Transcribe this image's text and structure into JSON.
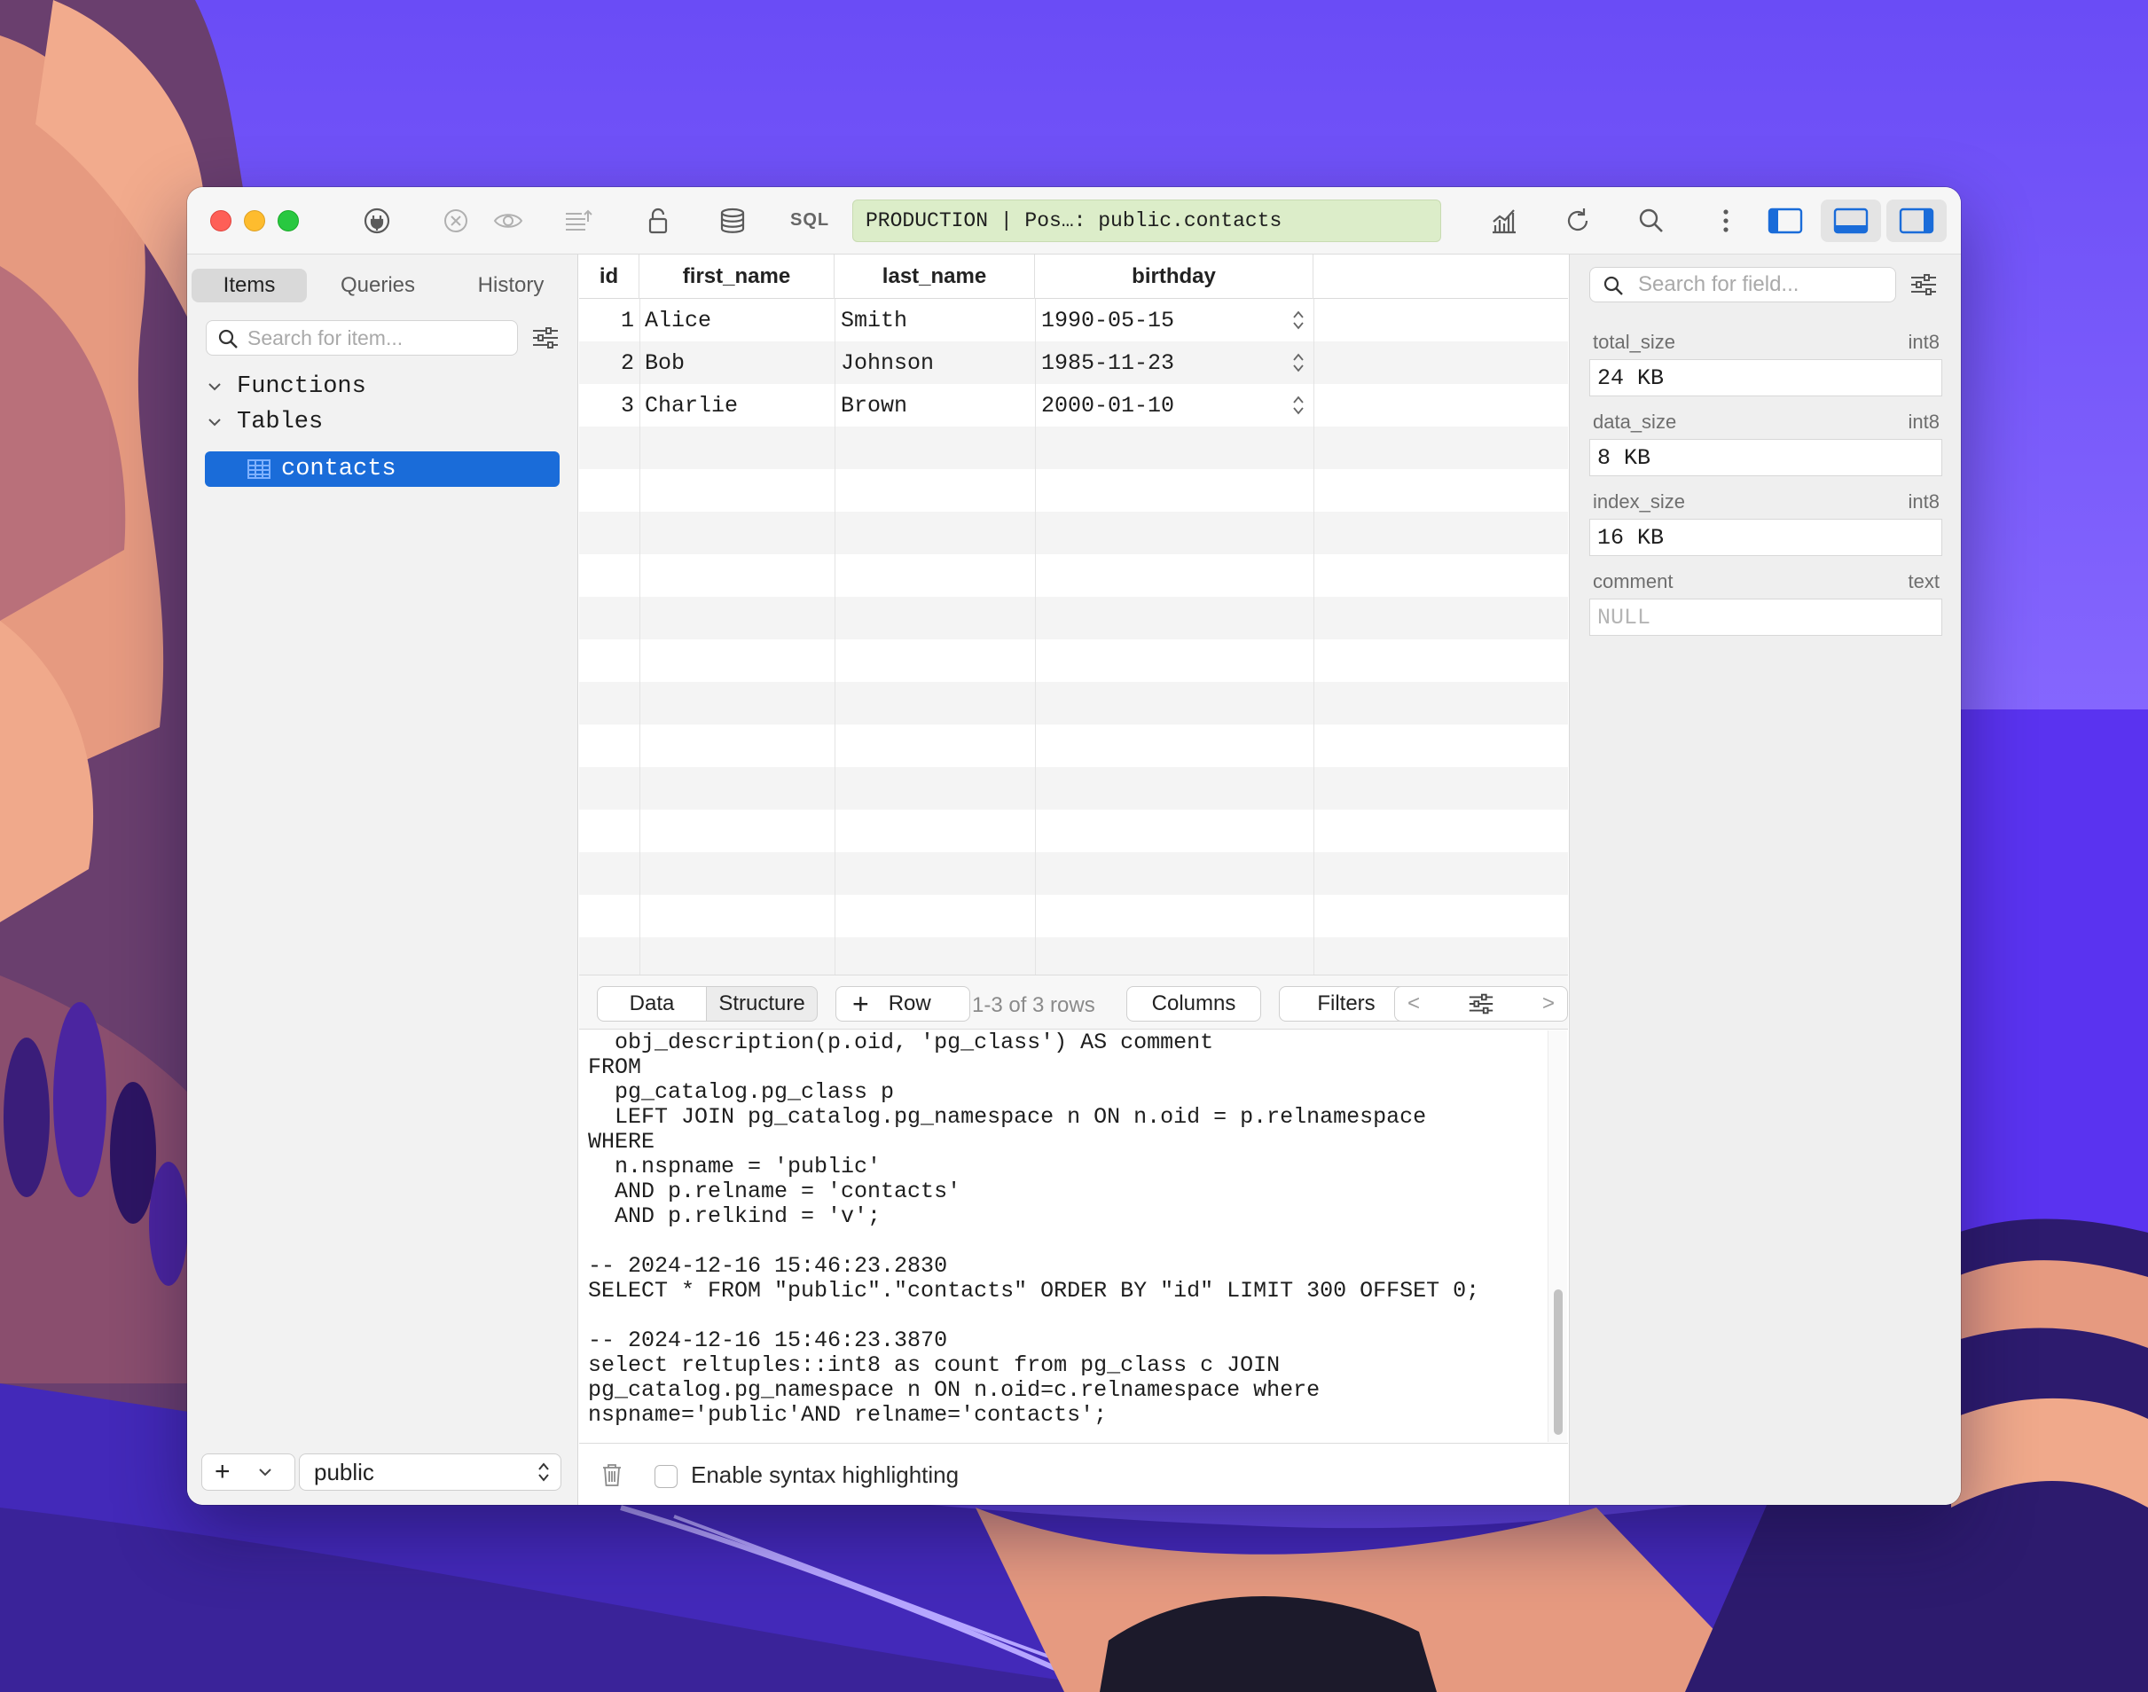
{
  "colors": {
    "accent": "#1a6cd9",
    "connection_bg": "#dcedc9",
    "traffic_red": "#fe5f57",
    "traffic_yellow": "#febc2e",
    "traffic_green": "#28c840"
  },
  "toolbar": {
    "icons": [
      "plug-icon",
      "close-circle-icon",
      "eye-icon",
      "list-icon",
      "lock-icon",
      "database-icon",
      "chart-icon",
      "refresh-icon",
      "search-icon",
      "more-icon",
      "left-panel-icon",
      "bottom-panel-icon",
      "right-panel-icon"
    ],
    "sql_label": "SQL",
    "connection": "PRODUCTION | Pos…: public.contacts"
  },
  "sidebar": {
    "tabs": [
      "Items",
      "Queries",
      "History"
    ],
    "active_tab": "Items",
    "search_placeholder": "Search for item...",
    "tree": {
      "functions": "Functions",
      "tables": "Tables",
      "selected_table": "contacts"
    },
    "add_label": "+",
    "schema": "public"
  },
  "grid": {
    "columns": [
      "id",
      "first_name",
      "last_name",
      "birthday"
    ],
    "rows": [
      {
        "id": "1",
        "first_name": "Alice",
        "last_name": "Smith",
        "birthday": "1990-05-15"
      },
      {
        "id": "2",
        "first_name": "Bob",
        "last_name": "Johnson",
        "birthday": "1985-11-23"
      },
      {
        "id": "3",
        "first_name": "Charlie",
        "last_name": "Brown",
        "birthday": "2000-01-10"
      }
    ]
  },
  "bottom_bar": {
    "data_tab": "Data",
    "structure_tab": "Structure",
    "add_row_plus": "+",
    "add_row_label": "Row",
    "row_count": "1-3 of 3 rows",
    "columns_label": "Columns",
    "filters_label": "Filters",
    "prev": "<",
    "next": ">"
  },
  "sql_log": {
    "lines": [
      "  obj_description(p.oid, 'pg_class') AS comment",
      "FROM",
      "  pg_catalog.pg_class p",
      "  LEFT JOIN pg_catalog.pg_namespace n ON n.oid = p.relnamespace",
      "WHERE",
      "  n.nspname = 'public'",
      "  AND p.relname = 'contacts'",
      "  AND p.relkind = 'v';",
      "",
      "-- 2024-12-16 15:46:23.2830",
      "SELECT * FROM \"public\".\"contacts\" ORDER BY \"id\" LIMIT 300 OFFSET 0;",
      "",
      "-- 2024-12-16 15:46:23.3870",
      "select reltuples::int8 as count from pg_class c JOIN",
      "pg_catalog.pg_namespace n ON n.oid=c.relnamespace where",
      "nspname='public'AND relname='contacts';"
    ],
    "syntax_label": "Enable syntax highlighting"
  },
  "inspector": {
    "search_placeholder": "Search for field...",
    "fields": [
      {
        "name": "total_size",
        "type": "int8",
        "value": "24 KB"
      },
      {
        "name": "data_size",
        "type": "int8",
        "value": "8 KB"
      },
      {
        "name": "index_size",
        "type": "int8",
        "value": "16 KB"
      },
      {
        "name": "comment",
        "type": "text",
        "value": "NULL"
      }
    ]
  }
}
